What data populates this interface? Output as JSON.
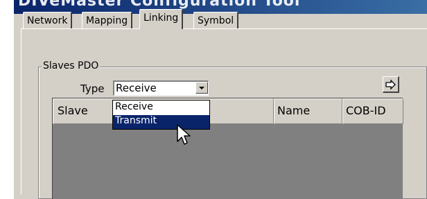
{
  "window": {
    "title": "DIVeMaster Configuration Tool"
  },
  "tabs": [
    {
      "label": "Network",
      "selected": false
    },
    {
      "label": "Mapping",
      "selected": false
    },
    {
      "label": "Linking",
      "selected": true
    },
    {
      "label": "Symbol",
      "selected": false
    }
  ],
  "slaves_pdo": {
    "group_title": "Slaves PDO",
    "type_label": "Type",
    "type_value": "Receive",
    "type_options": [
      "Receive",
      "Transmit"
    ],
    "highlighted_option": "Transmit",
    "columns": [
      "Slave",
      "Name",
      "COB-ID"
    ]
  },
  "icons": {
    "dropdown_arrow": "chevron-down-icon",
    "go_button": "arrow-right-icon",
    "mouse_pointer": "mouse-cursor-icon"
  },
  "colors": {
    "face": "#d4d0c8",
    "selection": "#0a246a",
    "list_background": "#808080"
  }
}
